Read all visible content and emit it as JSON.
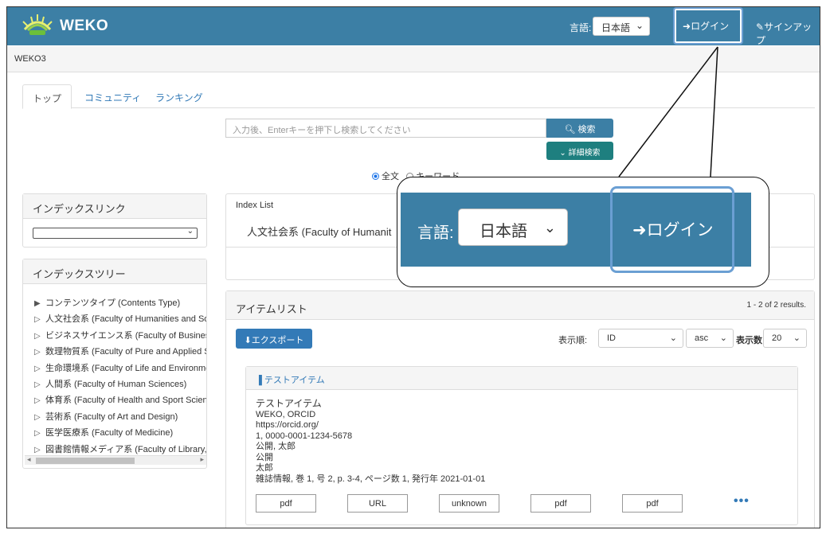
{
  "header": {
    "brand": "WEKO",
    "lang_label": "言語:",
    "lang_value": "日本語",
    "login": "ログイン",
    "signup": "サインアップ",
    "bg_color": "#3c7fa5"
  },
  "breadcrumb": "WEKO3",
  "tabs": [
    {
      "label": "トップ",
      "active": true
    },
    {
      "label": "コミュニティ",
      "active": false
    },
    {
      "label": "ランキング",
      "active": false
    }
  ],
  "search": {
    "placeholder": "入力後、Enterキーを押下し検索してください",
    "search_label": "検索",
    "advanced_label": "詳細検索",
    "radio_fulltext": "全文",
    "radio_keyword": "キーワード"
  },
  "index_link": {
    "title": "インデックスリンク",
    "selected": ""
  },
  "index_tree": {
    "title": "インデックスツリー",
    "items": [
      "コンテンツタイプ (Contents Type)",
      "人文社会系 (Faculty of Humanities and So",
      "ビジネスサイエンス系 (Faculty of Busines",
      "数理物質系 (Faculty of Pure and Applied S",
      "生命環境系 (Faculty of Life and Environme",
      "人間系 (Faculty of Human Sciences)",
      "体育系 (Faculty of Health and Sport Scien",
      "芸術系 (Faculty of Art and Design)",
      "医学医療系 (Faculty of Medicine)",
      "図書館情報メディア系 (Faculty of Library,"
    ]
  },
  "index_list": {
    "title": "Index List",
    "entry": "人文社会系 (Faculty of Humanit"
  },
  "items": {
    "title": "アイテムリスト",
    "results": "1 - 2 of 2 results.",
    "export_label": "エクスポート",
    "sort_label": "表示順:",
    "sort_field": "ID",
    "sort_order": "asc",
    "show_label": "表示数",
    "show_count": "20",
    "card": {
      "title": "テストアイテム",
      "lines": [
        "テストアイテム",
        "WEKO, ORCID",
        "https://orcid.org/",
        "1, 0000-0001-1234-5678",
        "公開, 太郎",
        "公開",
        "太郎",
        "雑誌情報, 巻 1, 号 2, p. 3-4, ページ数 1, 発行年 2021-01-01"
      ],
      "files": [
        "pdf",
        "URL",
        "unknown",
        "pdf",
        "pdf"
      ],
      "more": "•••"
    }
  },
  "callout": {
    "lang_label": "言語:",
    "lang_value": "日本語",
    "login": "ログイン"
  }
}
